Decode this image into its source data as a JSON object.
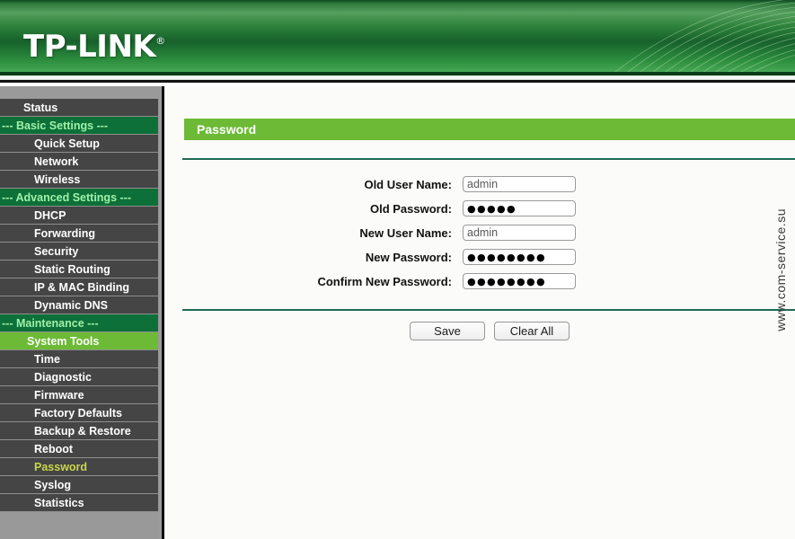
{
  "header": {
    "logo_text": "TP-LINK",
    "logo_mark": "®",
    "brand_green": "#2c8039",
    "accent_green": "#6cba35"
  },
  "sidebar": {
    "items": [
      {
        "label": "Status",
        "type": "item",
        "level": 1,
        "state": "normal"
      },
      {
        "label": "--- Basic Settings ---",
        "type": "section",
        "level": 0,
        "state": "normal"
      },
      {
        "label": "Quick Setup",
        "type": "item",
        "level": 2,
        "state": "normal"
      },
      {
        "label": "Network",
        "type": "item",
        "level": 2,
        "state": "normal"
      },
      {
        "label": "Wireless",
        "type": "item",
        "level": 2,
        "state": "normal"
      },
      {
        "label": "--- Advanced Settings ---",
        "type": "section",
        "level": 0,
        "state": "normal"
      },
      {
        "label": "DHCP",
        "type": "item",
        "level": 2,
        "state": "normal"
      },
      {
        "label": "Forwarding",
        "type": "item",
        "level": 2,
        "state": "normal"
      },
      {
        "label": "Security",
        "type": "item",
        "level": 2,
        "state": "normal"
      },
      {
        "label": "Static Routing",
        "type": "item",
        "level": 2,
        "state": "normal"
      },
      {
        "label": "IP & MAC Binding",
        "type": "item",
        "level": 2,
        "state": "normal"
      },
      {
        "label": "Dynamic DNS",
        "type": "item",
        "level": 2,
        "state": "normal"
      },
      {
        "label": "--- Maintenance ---",
        "type": "section",
        "level": 0,
        "state": "normal"
      },
      {
        "label": "System Tools",
        "type": "group",
        "level": 2,
        "state": "expanded"
      },
      {
        "label": "Time",
        "type": "item",
        "level": 2,
        "state": "normal"
      },
      {
        "label": "Diagnostic",
        "type": "item",
        "level": 2,
        "state": "normal"
      },
      {
        "label": "Firmware",
        "type": "item",
        "level": 2,
        "state": "normal"
      },
      {
        "label": "Factory Defaults",
        "type": "item",
        "level": 2,
        "state": "normal"
      },
      {
        "label": "Backup & Restore",
        "type": "item",
        "level": 2,
        "state": "normal"
      },
      {
        "label": "Reboot",
        "type": "item",
        "level": 2,
        "state": "normal"
      },
      {
        "label": "Password",
        "type": "item",
        "level": 2,
        "state": "active"
      },
      {
        "label": "Syslog",
        "type": "item",
        "level": 2,
        "state": "normal"
      },
      {
        "label": "Statistics",
        "type": "item",
        "level": 2,
        "state": "normal"
      }
    ]
  },
  "main": {
    "page_title": "Password",
    "fields": [
      {
        "label": "Old User Name:",
        "value": "admin",
        "type": "text"
      },
      {
        "label": "Old Password:",
        "value": "●●●●●",
        "type": "password"
      },
      {
        "label": "New User Name:",
        "value": "admin",
        "type": "text"
      },
      {
        "label": "New Password:",
        "value": "●●●●●●●●",
        "type": "password"
      },
      {
        "label": "Confirm New Password:",
        "value": "●●●●●●●●",
        "type": "password"
      }
    ],
    "buttons": [
      {
        "label": "Save"
      },
      {
        "label": "Clear All"
      }
    ]
  },
  "watermark": {
    "text": "www.com-service.su"
  }
}
